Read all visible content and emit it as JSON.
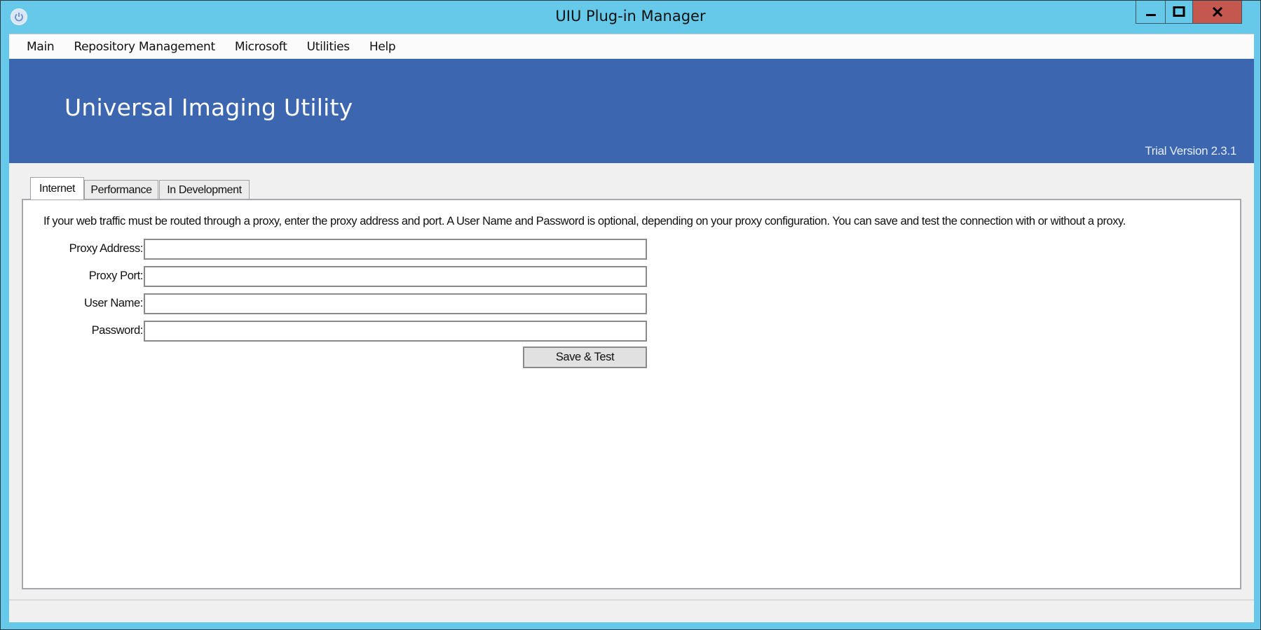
{
  "window": {
    "title": "UIU Plug-in Manager",
    "icon": "power-icon",
    "controls": {
      "minimize": "minimize-icon",
      "maximize": "maximize-icon",
      "close": "close-icon"
    }
  },
  "menu": {
    "items": [
      {
        "label": "Main"
      },
      {
        "label": "Repository Management"
      },
      {
        "label": "Microsoft"
      },
      {
        "label": "Utilities"
      },
      {
        "label": "Help"
      }
    ]
  },
  "banner": {
    "title": "Universal Imaging Utility",
    "version": "Trial Version 2.3.1",
    "color": "#3c66b0"
  },
  "tabs": [
    {
      "label": "Internet",
      "active": true
    },
    {
      "label": "Performance",
      "active": false
    },
    {
      "label": "In Development",
      "active": false
    }
  ],
  "internet": {
    "help_text": "If your web traffic must be routed through a proxy, enter the proxy address and port. A User Name and Password is optional, depending on your proxy configuration. You can save and test the connection with or without a proxy.",
    "fields": [
      {
        "label": "Proxy Address:",
        "value": ""
      },
      {
        "label": "Proxy Port:",
        "value": ""
      },
      {
        "label": "User Name:",
        "value": ""
      },
      {
        "label": "Password:",
        "value": ""
      }
    ],
    "save_button": "Save & Test"
  },
  "colors": {
    "window_frame": "#66c9ea",
    "close_button": "#c4584f"
  }
}
